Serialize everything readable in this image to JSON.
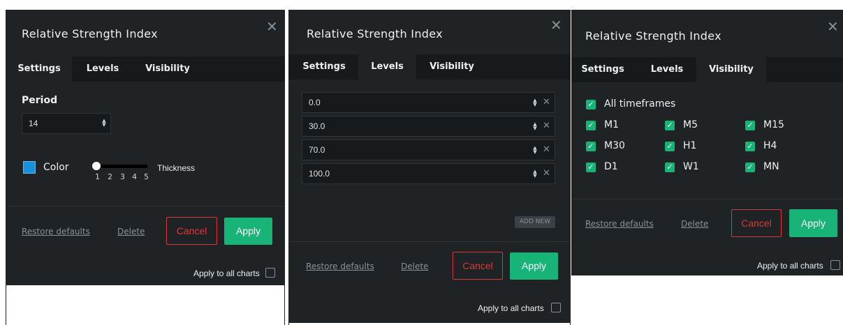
{
  "dialog1": {
    "title": "Relative Strength Index",
    "close": "✕",
    "tabs": [
      "Settings",
      "Levels",
      "Visibility"
    ],
    "period_label": "Period",
    "period_value": "14",
    "color_label": "Color",
    "color_hex": "#1a8fe0",
    "thickness_label": "Thickness",
    "thickness_ticks": [
      "1",
      "2",
      "3",
      "4",
      "5"
    ],
    "thickness_value": 1,
    "restore": "Restore defaults",
    "delete": "Delete",
    "cancel": "Cancel",
    "apply": "Apply",
    "apply_all": "Apply to all charts"
  },
  "dialog2": {
    "title": "Relative Strength Index",
    "close": "✕",
    "tabs": [
      "Settings",
      "Levels",
      "Visibility"
    ],
    "levels": [
      "0.0",
      "30.0",
      "70.0",
      "100.0"
    ],
    "add_new": "ADD NEW",
    "restore": "Restore defaults",
    "delete": "Delete",
    "cancel": "Cancel",
    "apply": "Apply",
    "apply_all": "Apply to all charts"
  },
  "dialog3": {
    "title": "Relative Strength Index",
    "close": "✕",
    "tabs": [
      "Settings",
      "Levels",
      "Visibility"
    ],
    "all_timeframes": "All timeframes",
    "timeframes": [
      "M1",
      "M5",
      "M15",
      "M30",
      "H1",
      "H4",
      "D1",
      "W1",
      "MN"
    ],
    "restore": "Restore defaults",
    "delete": "Delete",
    "cancel": "Cancel",
    "apply": "Apply",
    "apply_all": "Apply to all charts"
  },
  "colors": {
    "accent": "#18b377",
    "cancel": "#d63a3a",
    "panel": "#1f2326",
    "tabbar": "#161a1c"
  }
}
